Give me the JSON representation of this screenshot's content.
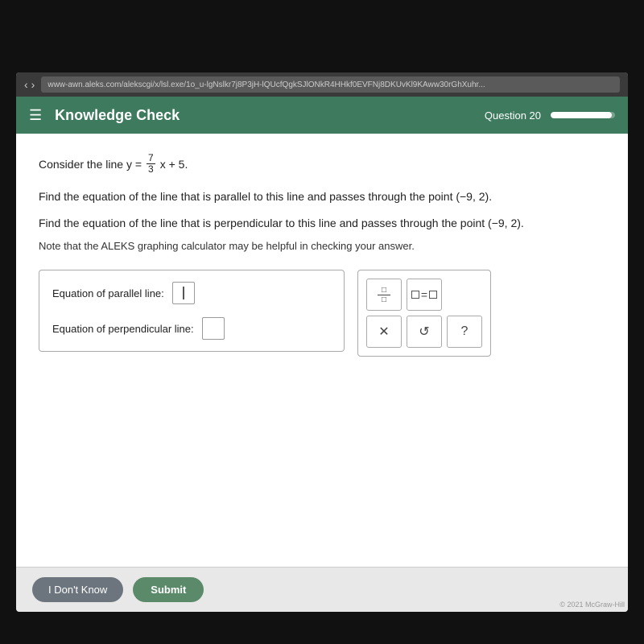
{
  "browser": {
    "url": "www-awn.aleks.com/alekscgi/x/lsl.exe/1o_u-lgNslkr7j8P3jH-lQUcfQgkSJlONkR4HHkf0EVFNj8DKUvKl9KAww30rGhXuhr..."
  },
  "header": {
    "title": "Knowledge Check",
    "question_label": "Question 20",
    "progress_percent": 95
  },
  "problem": {
    "intro": "Consider the line y =",
    "fraction_num": "7",
    "fraction_den": "3",
    "equation_suffix": "x + 5.",
    "parallel_statement": "Find the equation of the line that is parallel to this line and passes through the point (−9,  2).",
    "perpendicular_statement": "Find the equation of the line that is perpendicular to this line and passes through the point (−9,  2).",
    "note": "Note that the ALEKS graphing calculator may be helpful in checking your answer."
  },
  "inputs": {
    "parallel_label": "Equation of parallel line:",
    "perpendicular_label": "Equation of perpendicular line:"
  },
  "keyboard": {
    "buttons": [
      "fraction",
      "equals",
      "x",
      "times",
      "undo",
      "help"
    ]
  },
  "footer": {
    "dont_know_label": "I Don't Know",
    "submit_label": "Submit"
  },
  "copyright": "© 2021 McGraw-Hill"
}
